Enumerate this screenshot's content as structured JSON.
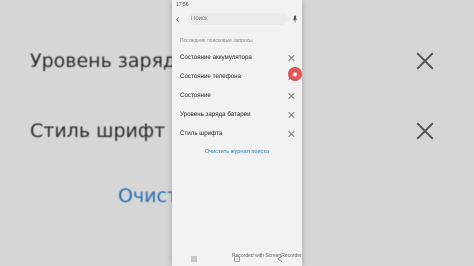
{
  "status": {
    "time": "17:56"
  },
  "search": {
    "placeholder": "Поиск"
  },
  "history": {
    "title": "Последние поисковые запросы",
    "items": [
      {
        "label": "Состояние аккумулятора"
      },
      {
        "label": "Состояние телефона"
      },
      {
        "label": "Состояние"
      },
      {
        "label": "Уровень заряда батареи"
      },
      {
        "label": "Стиль шрифта"
      }
    ],
    "clear_label": "Очистить журнал поиска"
  },
  "background": {
    "row1": "Уровень заряд",
    "row2": "Стиль шрифт",
    "link": "Очист                    поиска"
  },
  "watermark": "Recorded with ScreenRecorder",
  "colors": {
    "accent": "#2a7bc0",
    "badge": "#e0545a"
  }
}
